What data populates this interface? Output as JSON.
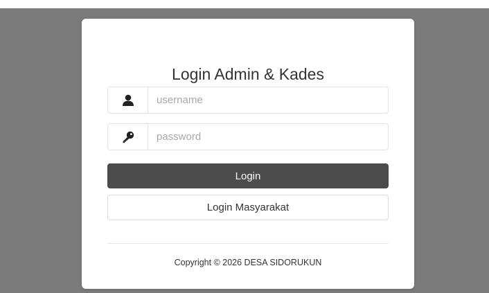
{
  "colors": {
    "background": "#7a7a7a",
    "card": "#ffffff",
    "login_button": "#4c4c4c",
    "text": "#333333"
  },
  "login_card": {
    "title": "Login Admin & Kades",
    "username": {
      "icon": "user-icon",
      "placeholder": "username",
      "value": ""
    },
    "password": {
      "icon": "key-icon",
      "placeholder": "password",
      "value": ""
    },
    "login_button_label": "Login",
    "masyarakat_button_label": "Login Masyarakat",
    "copyright": "Copyright © 2026 DESA SIDORUKUN"
  }
}
